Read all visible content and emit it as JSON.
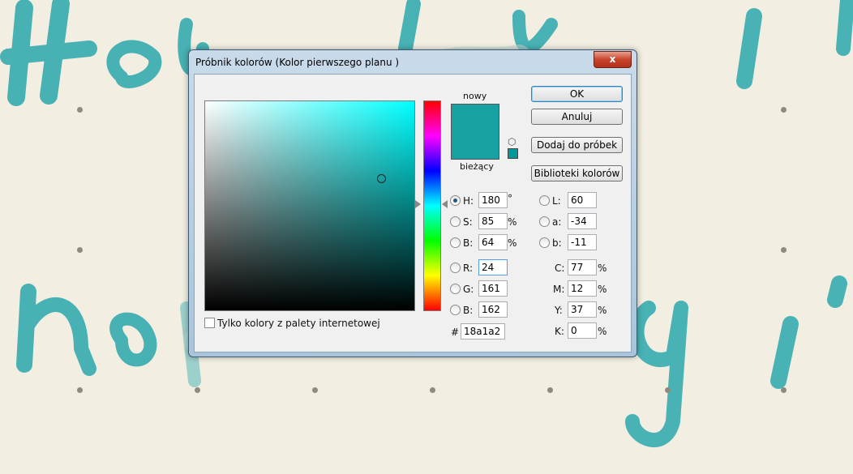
{
  "dialog": {
    "title": "Próbnik kolorów (Kolor pierwszego planu )",
    "close_glyph": "x"
  },
  "colors": {
    "current": "#18a1a2",
    "websafe": "#00999a"
  },
  "swatch": {
    "new_label": "nowy",
    "current_label": "bieżący"
  },
  "buttons": {
    "ok": "OK",
    "cancel": "Anuluj",
    "add_swatch": "Dodaj do próbek",
    "libraries": "Biblioteki kolorów"
  },
  "hsb": {
    "h": {
      "label": "H:",
      "value": "180",
      "unit": "°"
    },
    "s": {
      "label": "S:",
      "value": "85",
      "unit": "%"
    },
    "b": {
      "label": "B:",
      "value": "64",
      "unit": "%"
    }
  },
  "rgb": {
    "r": {
      "label": "R:",
      "value": "24"
    },
    "g": {
      "label": "G:",
      "value": "161"
    },
    "b": {
      "label": "B:",
      "value": "162"
    }
  },
  "lab": {
    "l": {
      "label": "L:",
      "value": "60"
    },
    "a": {
      "label": "a:",
      "value": "-34"
    },
    "b": {
      "label": "b:",
      "value": "-11"
    }
  },
  "cmyk": {
    "c": {
      "label": "C:",
      "value": "77",
      "unit": "%"
    },
    "m": {
      "label": "M:",
      "value": "12",
      "unit": "%"
    },
    "y": {
      "label": "Y:",
      "value": "37",
      "unit": "%"
    },
    "k": {
      "label": "K:",
      "value": "0",
      "unit": "%"
    }
  },
  "hex": {
    "label": "#",
    "value": "18a1a2"
  },
  "web_only": {
    "label": "Tylko kolory z palety internetowej",
    "checked": false
  },
  "background": {
    "brush_text_top": "Hello, wor!",
    "brush_text_bottom": "nature gi!"
  }
}
